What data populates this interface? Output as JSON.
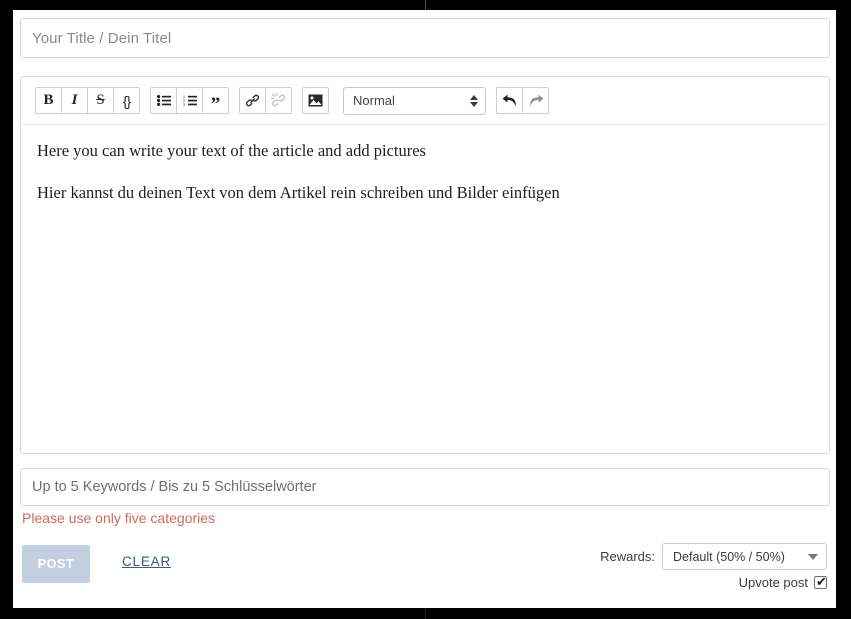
{
  "title_field": {
    "placeholder": "Your Title / Dein Titel",
    "value": ""
  },
  "toolbar": {
    "groups": [
      {
        "name": "inline-format",
        "buttons": [
          {
            "name": "bold-button",
            "icon": "bold-icon",
            "label": "B"
          },
          {
            "name": "italic-button",
            "icon": "italic-icon",
            "label": "I"
          },
          {
            "name": "strikethrough-button",
            "icon": "strikethrough-icon",
            "label": "S"
          },
          {
            "name": "code-button",
            "icon": "code-braces-icon",
            "label": "{}"
          }
        ]
      },
      {
        "name": "lists",
        "buttons": [
          {
            "name": "bullet-list-button",
            "icon": "bullet-list-icon",
            "label": ""
          },
          {
            "name": "numbered-list-button",
            "icon": "numbered-list-icon",
            "label": ""
          },
          {
            "name": "blockquote-button",
            "icon": "quote-icon",
            "label": "”"
          }
        ]
      },
      {
        "name": "links",
        "buttons": [
          {
            "name": "link-button",
            "icon": "link-icon",
            "label": ""
          },
          {
            "name": "unlink-button",
            "icon": "unlink-icon",
            "label": ""
          }
        ]
      },
      {
        "name": "media",
        "buttons": [
          {
            "name": "insert-image-button",
            "icon": "image-icon",
            "label": ""
          }
        ]
      },
      {
        "name": "history",
        "buttons": [
          {
            "name": "undo-button",
            "icon": "undo-arrow-icon",
            "label": ""
          },
          {
            "name": "redo-button",
            "icon": "redo-arrow-icon",
            "label": ""
          }
        ]
      }
    ],
    "format_select": {
      "selected": "Normal",
      "options": [
        "Normal"
      ],
      "icon": "up-down-caret-icon"
    }
  },
  "body": {
    "paragraphs": [
      "Here you can write your text of the article and add pictures",
      "Hier kannst du deinen Text von dem Artikel rein schreiben und Bilder einfügen"
    ],
    "line_en": "Here you can write your text of the article and add pictures",
    "line_de": "Hier kannst du deinen Text von dem Artikel rein schreiben und Bilder einfügen"
  },
  "keywords_field": {
    "placeholder": "Up to 5 Keywords / Bis zu 5 Schlüsselwörter",
    "value": "",
    "error": "Please use only five categories"
  },
  "footer": {
    "post_label": "POST",
    "clear_label": "CLEAR",
    "rewards_label": "Rewards:",
    "rewards_selected": "Default (50% / 50%)",
    "rewards_options": [
      "Default (50% / 50%)"
    ],
    "upvote_label": "Upvote post",
    "upvote_checked": true,
    "upvote_check_glyph": "✔"
  },
  "colors": {
    "error_text": "#d0695a",
    "post_disabled_bg": "#c3d0e0",
    "clear_link": "#3c5a7a",
    "placeholder": "#8a8a8a",
    "border": "#d9d9d9",
    "frame": "#000000"
  }
}
